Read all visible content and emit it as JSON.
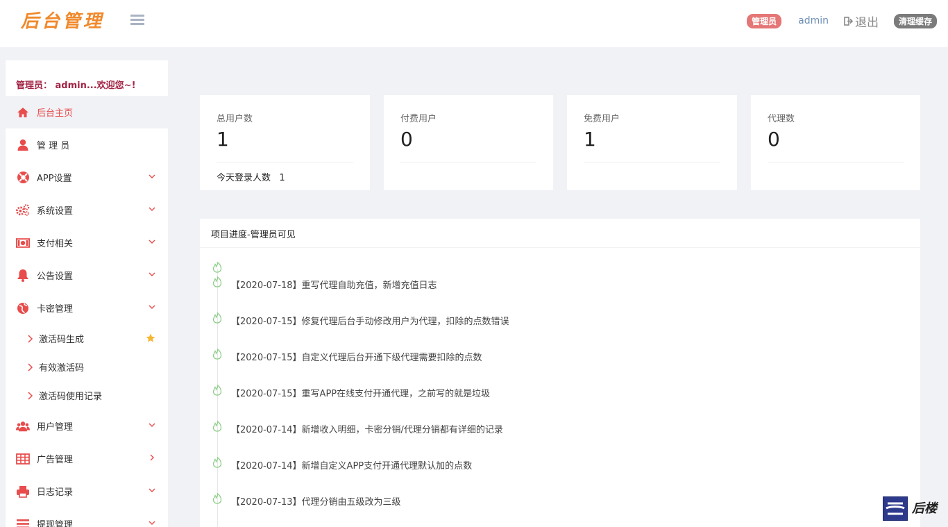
{
  "header": {
    "logo": "后台管理",
    "role_badge": "管理员",
    "username": "admin",
    "logout_label": "退出",
    "clear_cache_label": "清理缓存"
  },
  "sidebar": {
    "welcome": "管理员： admin...欢迎您~!",
    "items": [
      {
        "label": "后台主页",
        "icon": "home-icon"
      },
      {
        "label": "管 理 员",
        "icon": "user-icon"
      },
      {
        "label": "APP设置",
        "icon": "lifebuoy-icon"
      },
      {
        "label": "系统设置",
        "icon": "gears-icon"
      },
      {
        "label": "支付相关",
        "icon": "money-icon"
      },
      {
        "label": "公告设置",
        "icon": "bell-icon"
      },
      {
        "label": "卡密管理",
        "icon": "globe-icon"
      },
      {
        "label": "用户管理",
        "icon": "users-icon"
      },
      {
        "label": "广告管理",
        "icon": "table-icon"
      },
      {
        "label": "日志记录",
        "icon": "printer-icon"
      },
      {
        "label": "提现管理",
        "icon": "list-icon"
      }
    ],
    "sub_items": [
      {
        "label": "激活码生成"
      },
      {
        "label": "有效激活码"
      },
      {
        "label": "激活码使用记录"
      }
    ]
  },
  "stats": [
    {
      "label": "总用户数",
      "value": "1",
      "extra": "今天登录人数   1"
    },
    {
      "label": "付费用户",
      "value": "0"
    },
    {
      "label": "免费用户",
      "value": "1"
    },
    {
      "label": "代理数",
      "value": "0"
    }
  ],
  "progress": {
    "title": "项目进度-管理员可见",
    "entries": [
      "【2020-07-18】重写代理自助充值，新增充值日志",
      "【2020-07-15】修复代理后台手动修改用户为代理，扣除的点数错误",
      "【2020-07-15】自定义代理后台开通下级代理需要扣除的点数",
      "【2020-07-15】重写APP在线支付开通代理，之前写的就是垃圾",
      "【2020-07-14】新增收入明细，卡密分销/代理分销都有详细的记录",
      "【2020-07-14】新增自定义APP支付开通代理默认加的点数",
      "【2020-07-13】代理分销由五级改为三级"
    ]
  },
  "watermark": {
    "text": "后楼"
  },
  "colors": {
    "accent": "#e84c4c",
    "logo": "#f0892c",
    "badge_admin": "#e57676",
    "badge_cache": "#7b7b7b"
  }
}
